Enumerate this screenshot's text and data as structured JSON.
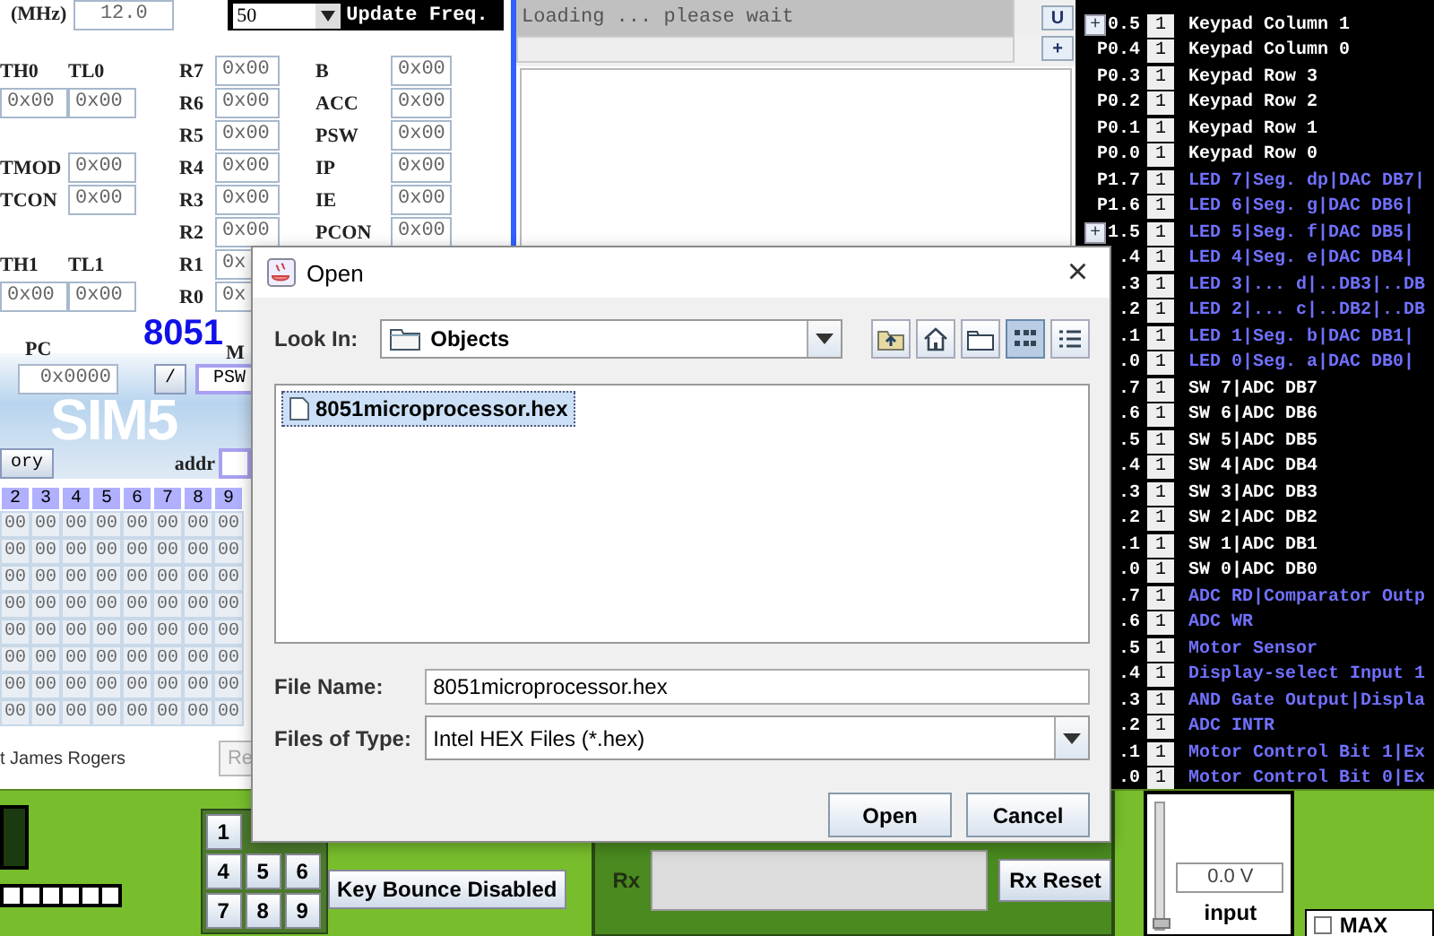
{
  "simulator": {
    "clock": {
      "label": "(MHz)",
      "value": "12.0"
    },
    "update": {
      "value": "50",
      "label": "Update Freq."
    },
    "timer_pairs": [
      {
        "high": {
          "label": "TH0",
          "value": "0x00"
        },
        "low": {
          "label": "TL0",
          "value": "0x00"
        }
      },
      {
        "high": {
          "label": "TH1",
          "value": "0x00"
        },
        "low": {
          "label": "TL1",
          "value": "0x00"
        }
      }
    ],
    "timer_controls": [
      {
        "label": "TMOD",
        "value": "0x00"
      },
      {
        "label": "TCON",
        "value": "0x00"
      }
    ],
    "bank_registers": [
      {
        "label": "R7",
        "value": "0x00"
      },
      {
        "label": "R6",
        "value": "0x00"
      },
      {
        "label": "R5",
        "value": "0x00"
      },
      {
        "label": "R4",
        "value": "0x00"
      },
      {
        "label": "R3",
        "value": "0x00"
      },
      {
        "label": "R2",
        "value": "0x00"
      },
      {
        "label": "R1",
        "value": "0x"
      },
      {
        "label": "R0",
        "value": "0x"
      }
    ],
    "sfr_registers": [
      {
        "label": "B",
        "value": "0x00"
      },
      {
        "label": "ACC",
        "value": "0x00"
      },
      {
        "label": "PSW",
        "value": "0x00"
      },
      {
        "label": "IP",
        "value": "0x00"
      },
      {
        "label": "IE",
        "value": "0x00"
      },
      {
        "label": "PCON",
        "value": "0x00"
      }
    ],
    "chip": "8051",
    "pc": {
      "label": "PC",
      "value": "0x0000"
    },
    "pc_buttons": [
      "/",
      "PSW"
    ],
    "logo": "SIM5",
    "m_label": "M",
    "memory_button": "ory",
    "addr": {
      "label": "addr"
    },
    "memory": {
      "columns": [
        "2",
        "3",
        "4",
        "5",
        "6",
        "7",
        "8",
        "9"
      ],
      "rows": [
        [
          "00",
          "00",
          "00",
          "00",
          "00",
          "00",
          "00",
          "00"
        ],
        [
          "00",
          "00",
          "00",
          "00",
          "00",
          "00",
          "00",
          "00"
        ],
        [
          "00",
          "00",
          "00",
          "00",
          "00",
          "00",
          "00",
          "00"
        ],
        [
          "00",
          "00",
          "00",
          "00",
          "00",
          "00",
          "00",
          "00"
        ],
        [
          "00",
          "00",
          "00",
          "00",
          "00",
          "00",
          "00",
          "00"
        ],
        [
          "00",
          "00",
          "00",
          "00",
          "00",
          "00",
          "00",
          "00"
        ],
        [
          "00",
          "00",
          "00",
          "00",
          "00",
          "00",
          "00",
          "00"
        ],
        [
          "00",
          "00",
          "00",
          "00",
          "00",
          "00",
          "00",
          "00"
        ]
      ]
    },
    "author": "t James Rogers",
    "reset_button": {
      "label": "Re",
      "disabled": true
    }
  },
  "console": {
    "text": "Loading ... please wait",
    "buttons": [
      "U",
      "+"
    ]
  },
  "ports": [
    {
      "color": "#ffffff",
      "pins": [
        {
          "pin": "0.5",
          "value": "1",
          "label": "Keypad Column 1",
          "button": "+"
        },
        {
          "pin": "P0.4",
          "value": "1",
          "label": "Keypad Column 0"
        },
        {
          "pin": "P0.3",
          "value": "1",
          "label": "Keypad Row 3"
        },
        {
          "pin": "P0.2",
          "value": "1",
          "label": "Keypad Row 2"
        },
        {
          "pin": "P0.1",
          "value": "1",
          "label": "Keypad Row 1"
        },
        {
          "pin": "P0.0",
          "value": "1",
          "label": "Keypad Row 0"
        }
      ]
    },
    {
      "color": "#7070ff",
      "pins": [
        {
          "pin": "P1.7",
          "value": "1",
          "label": "LED 7|Seg. dp|DAC DB7|"
        },
        {
          "pin": "P1.6",
          "value": "1",
          "label": "LED 6|Seg. g|DAC DB6|"
        },
        {
          "pin": "1.5",
          "value": "1",
          "label": "LED 5|Seg. f|DAC DB5|",
          "button": "+"
        },
        {
          "pin": ".4",
          "value": "1",
          "label": "LED 4|Seg. e|DAC DB4|"
        },
        {
          "pin": ".3",
          "value": "1",
          "label": "LED 3|... d|..DB3|..DB"
        },
        {
          "pin": ".2",
          "value": "1",
          "label": "LED 2|... c|..DB2|..DB"
        },
        {
          "pin": ".1",
          "value": "1",
          "label": "LED 1|Seg. b|DAC DB1|"
        },
        {
          "pin": ".0",
          "value": "1",
          "label": "LED 0|Seg. a|DAC DB0|"
        }
      ]
    },
    {
      "color": "#ffffff",
      "pins": [
        {
          "pin": ".7",
          "value": "1",
          "label": "SW 7|ADC DB7"
        },
        {
          "pin": ".6",
          "value": "1",
          "label": "SW 6|ADC DB6"
        },
        {
          "pin": ".5",
          "value": "1",
          "label": "SW 5|ADC DB5"
        },
        {
          "pin": ".4",
          "value": "1",
          "label": "SW 4|ADC DB4"
        },
        {
          "pin": ".3",
          "value": "1",
          "label": "SW 3|ADC DB3"
        },
        {
          "pin": ".2",
          "value": "1",
          "label": "SW 2|ADC DB2"
        },
        {
          "pin": ".1",
          "value": "1",
          "label": "SW 1|ADC DB1"
        },
        {
          "pin": ".0",
          "value": "1",
          "label": "SW 0|ADC DB0"
        }
      ]
    },
    {
      "color": "#7070ff",
      "pins": [
        {
          "pin": ".7",
          "value": "1",
          "label": "ADC RD|Comparator Outp"
        },
        {
          "pin": ".6",
          "value": "1",
          "label": "ADC WR"
        },
        {
          "pin": ".5",
          "value": "1",
          "label": "Motor Sensor"
        },
        {
          "pin": ".4",
          "value": "1",
          "label": "Display-select Input 1"
        },
        {
          "pin": ".3",
          "value": "1",
          "label": "AND Gate Output|Displa"
        },
        {
          "pin": ".2",
          "value": "1",
          "label": "ADC INTR"
        },
        {
          "pin": ".1",
          "value": "1",
          "label": "Motor Control Bit 1|Ex"
        },
        {
          "pin": ".0",
          "value": "1",
          "label": "Motor Control Bit 0|Ex"
        }
      ]
    }
  ],
  "peripherals": {
    "keypad": [
      [
        "1"
      ],
      [
        "4",
        "5",
        "6"
      ],
      [
        "7",
        "8",
        "9"
      ]
    ],
    "key_bounce": "Key Bounce Disabled",
    "rx_label": "Rx",
    "rx_reset": "Rx Reset",
    "voltage": "0.0 V",
    "voltage_slider": {
      "level": 0
    },
    "input_label": "input",
    "max": {
      "label": "MAX",
      "checked": false
    }
  },
  "dialog": {
    "title": "Open",
    "close": "×",
    "look_in": {
      "label": "Look In:",
      "value": "Objects"
    },
    "toolbar": [
      {
        "kind": "up",
        "selected": false
      },
      {
        "kind": "home",
        "selected": false
      },
      {
        "kind": "new-folder",
        "selected": false
      },
      {
        "kind": "list",
        "selected": true
      },
      {
        "kind": "details",
        "selected": false
      }
    ],
    "files": [
      {
        "name": "8051microprocessor.hex",
        "selected": true
      }
    ],
    "file_name": {
      "label": "File Name:",
      "value": "8051microprocessor.hex"
    },
    "file_type": {
      "label": "Files of Type:",
      "value": "Intel HEX Files (*.hex)"
    },
    "buttons": [
      "Open",
      "Cancel"
    ]
  }
}
